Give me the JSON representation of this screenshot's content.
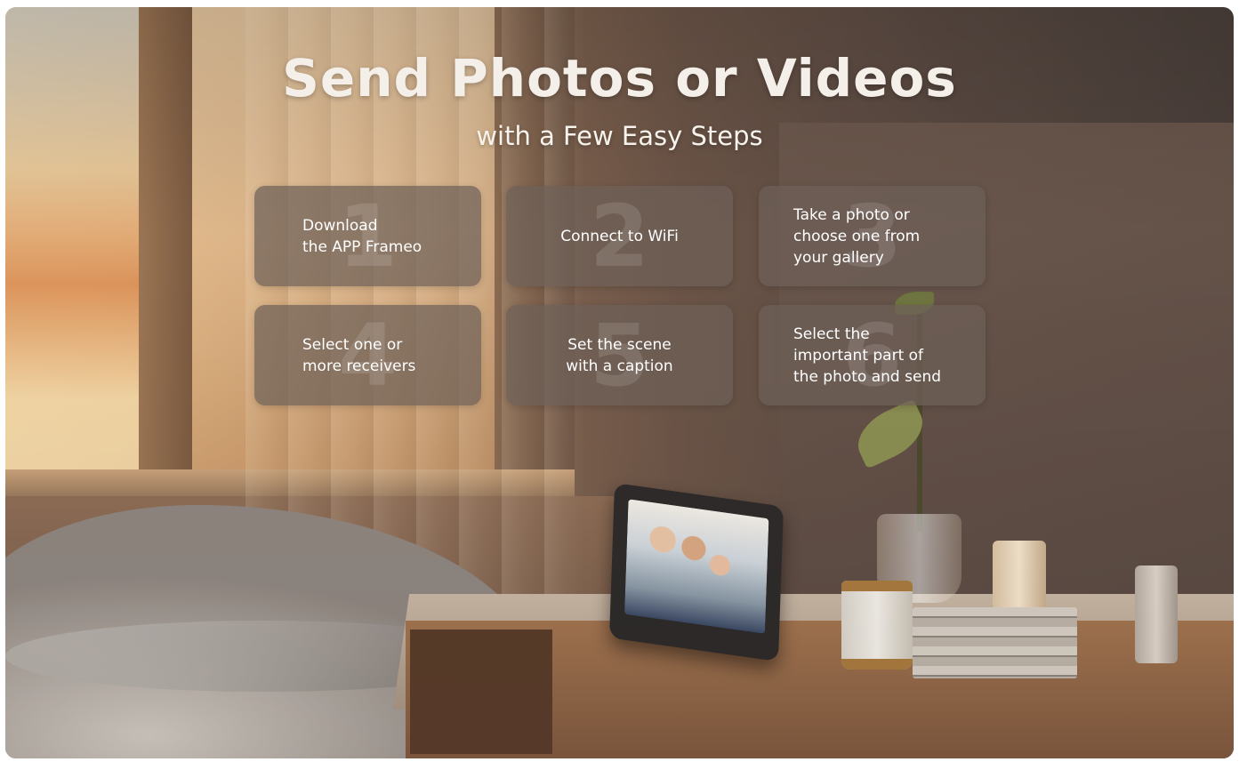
{
  "heading": {
    "title": "Send Photos or Videos",
    "subtitle": "with a Few Easy Steps"
  },
  "steps": [
    {
      "number": "1",
      "text": "Download\nthe APP Frameo"
    },
    {
      "number": "2",
      "text": "Connect to WiFi"
    },
    {
      "number": "3",
      "text": "Take a photo or\nchoose one from\nyour gallery"
    },
    {
      "number": "4",
      "text": "Select one or\nmore receivers"
    },
    {
      "number": "5",
      "text": "Set the scene\nwith a caption"
    },
    {
      "number": "6",
      "text": "Select the\nimportant part of\nthe photo and send"
    }
  ]
}
